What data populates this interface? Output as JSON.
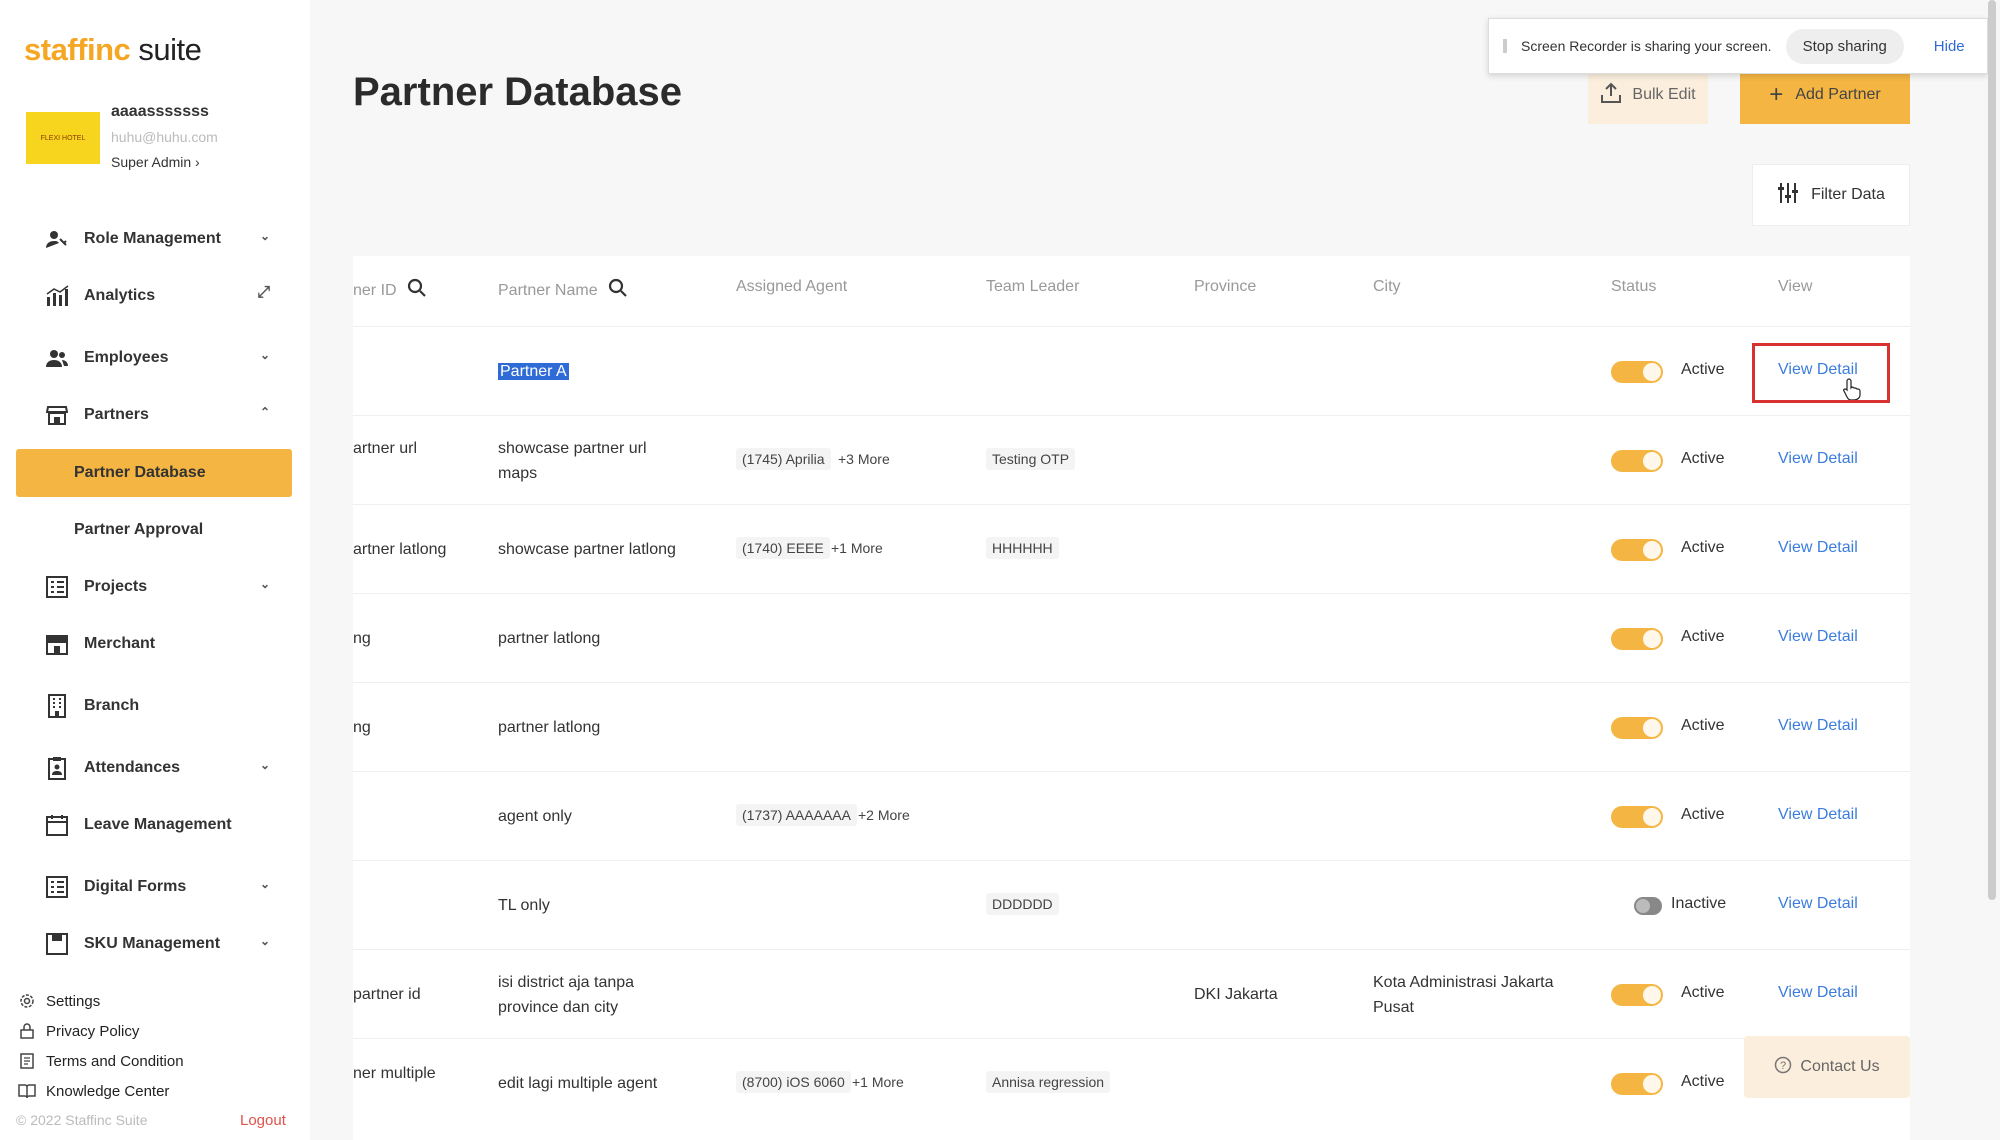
{
  "app": {
    "logo_a": "staffinc",
    "logo_b": " suite",
    "avatar_text": "FLEXI HOTEL"
  },
  "profile": {
    "username": "aaaasssssss",
    "email": "huhu@huhu.com",
    "role": "Super Admin ›"
  },
  "sidebar": {
    "items": [
      {
        "label": "Role Management",
        "icon": "user-key-icon",
        "chevron": "⌄"
      },
      {
        "label": "Analytics",
        "icon": "bar-chart-icon",
        "chevron": "⤢"
      },
      {
        "label": "Employees",
        "icon": "users-icon",
        "chevron": "⌄"
      },
      {
        "label": "Partners",
        "icon": "store-icon",
        "chevron": "⌃"
      },
      {
        "label": "Partner Database",
        "sub": true,
        "active": true
      },
      {
        "label": "Partner Approval",
        "sub": true
      },
      {
        "label": "Projects",
        "icon": "grid-list-icon",
        "chevron": "⌄"
      },
      {
        "label": "Merchant",
        "icon": "shop-icon",
        "chevron": ""
      },
      {
        "label": "Branch",
        "icon": "building-icon",
        "chevron": ""
      },
      {
        "label": "Attendances",
        "icon": "clipboard-icon",
        "chevron": "⌄"
      },
      {
        "label": "Leave Management",
        "icon": "calendar-icon",
        "chevron": ""
      },
      {
        "label": "Digital Forms",
        "icon": "form-icon",
        "chevron": "⌄"
      },
      {
        "label": "SKU Management",
        "icon": "box-icon",
        "chevron": "⌄"
      }
    ],
    "footer": [
      {
        "label": "Settings",
        "icon": "gear-icon"
      },
      {
        "label": "Privacy Policy",
        "icon": "lock-icon"
      },
      {
        "label": "Terms and Condition",
        "icon": "document-icon"
      },
      {
        "label": "Knowledge Center",
        "icon": "book-icon"
      }
    ],
    "copyright": "© 2022 Staffinc Suite",
    "logout": "Logout"
  },
  "header": {
    "title": "Partner Database",
    "bulk_edit": "Bulk Edit",
    "add_partner": "Add Partner",
    "filter": "Filter Data"
  },
  "share_banner": {
    "message": "Screen Recorder is sharing your screen.",
    "stop": "Stop sharing",
    "hide": "Hide"
  },
  "table": {
    "columns": [
      "ner ID",
      "Partner Name",
      "Assigned Agent",
      "Team Leader",
      "Province",
      "City",
      "Status",
      "View"
    ],
    "rows": [
      {
        "id": "",
        "name": "Partner A",
        "agent": "",
        "agent_more": "",
        "leader": "",
        "province": "",
        "city": "",
        "status": "Active",
        "active": true,
        "view": "View Detail"
      },
      {
        "id": "artner url",
        "name": "showcase partner url maps",
        "agent": "(1745) Aprilia",
        "agent_more": "+3 More",
        "leader": "Testing OTP",
        "province": "",
        "city": "",
        "status": "Active",
        "active": true,
        "view": "View Detail"
      },
      {
        "id": "artner latlong",
        "name": "showcase partner latlong",
        "agent": "(1740) EEEE",
        "agent_more": "+1 More",
        "leader": "HHHHHH",
        "province": "",
        "city": "",
        "status": "Active",
        "active": true,
        "view": "View Detail"
      },
      {
        "id": "ng",
        "name": "partner latlong",
        "agent": "",
        "agent_more": "",
        "leader": "",
        "province": "",
        "city": "",
        "status": "Active",
        "active": true,
        "view": "View Detail"
      },
      {
        "id": "ng",
        "name": "partner latlong",
        "agent": "",
        "agent_more": "",
        "leader": "",
        "province": "",
        "city": "",
        "status": "Active",
        "active": true,
        "view": "View Detail"
      },
      {
        "id": "",
        "name": "agent only",
        "agent": "(1737) AAAAAAA",
        "agent_more": "+2 More",
        "leader": "",
        "province": "",
        "city": "",
        "status": "Active",
        "active": true,
        "view": "View Detail"
      },
      {
        "id": "",
        "name": "TL only",
        "agent": "",
        "agent_more": "",
        "leader": "DDDDDD",
        "province": "",
        "city": "",
        "status": "Inactive",
        "active": false,
        "view": "View Detail"
      },
      {
        "id": "partner id",
        "name": "isi district aja tanpa province dan city",
        "agent": "",
        "agent_more": "",
        "leader": "",
        "province": "DKI Jakarta",
        "city": "Kota Administrasi Jakarta Pusat",
        "status": "Active",
        "active": true,
        "view": "View Detail"
      },
      {
        "id": "ner multiple",
        "name": "edit lagi multiple agent",
        "agent": "(8700) iOS 6060",
        "agent_more": "+1 More",
        "leader": "Annisa regression",
        "province": "",
        "city": "",
        "status": "Active",
        "active": true,
        "view": ""
      }
    ]
  },
  "contact": "Contact Us"
}
